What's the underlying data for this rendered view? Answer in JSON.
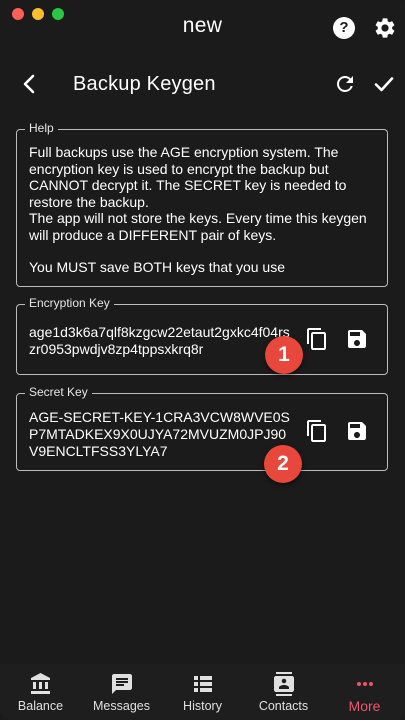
{
  "window": {
    "title": "new"
  },
  "header": {
    "title": "Backup Keygen"
  },
  "help": {
    "legend": "Help",
    "line1": "Full backups use the AGE encryption system. The encryption key is used to encrypt the backup but CANNOT decrypt it. The SECRET key is needed to restore the backup.",
    "line2": "The app will not store the keys. Every time this keygen will produce a DIFFERENT pair of keys.",
    "line3": "You MUST save BOTH keys that you use"
  },
  "encryption": {
    "legend": "Encryption Key",
    "value": "age1d3k6a7qlf8kzgcw22etaut2gxkc4f04rszr0953pwdjv8zp4tppsxkrq8r"
  },
  "secret": {
    "legend": "Secret Key",
    "value": "AGE-SECRET-KEY-1CRA3VCW8WVE0SP7MTADKEX9X0UJYA72MVUZM0JPJ90V9ENCLTFSS3YLYA7"
  },
  "badges": {
    "one": "1",
    "two": "2"
  },
  "nav": {
    "balance": "Balance",
    "messages": "Messages",
    "history": "History",
    "contacts": "Contacts",
    "more": "More"
  },
  "colors": {
    "accent": "#f0546a",
    "badge": "#e8473b",
    "background": "#1b1b1b"
  },
  "icons": [
    "help-icon",
    "gear-icon",
    "back-arrow-icon",
    "refresh-icon",
    "check-icon",
    "copy-icon",
    "save-icon",
    "bank-icon",
    "message-icon",
    "list-icon",
    "contact-icon",
    "dots-icon"
  ]
}
